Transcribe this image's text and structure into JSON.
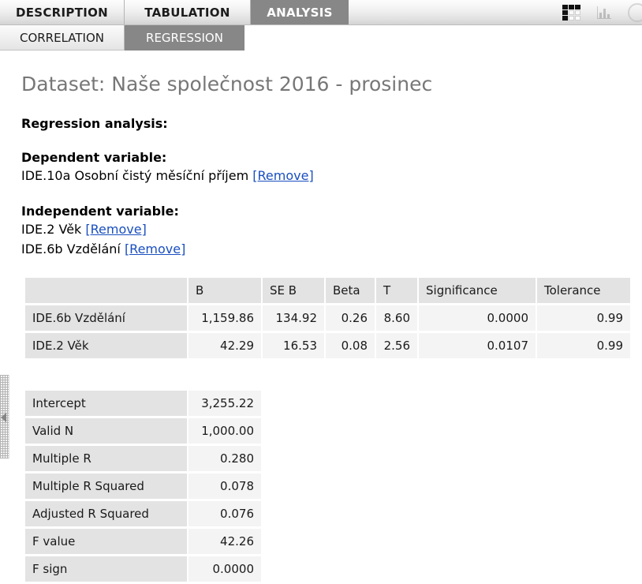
{
  "primary_tabs": [
    {
      "label": "DESCRIPTION",
      "active": false
    },
    {
      "label": "TABULATION",
      "active": false
    },
    {
      "label": "ANALYSIS",
      "active": true
    }
  ],
  "secondary_tabs": [
    {
      "label": "CORRELATION",
      "active": false
    },
    {
      "label": "REGRESSION",
      "active": true
    }
  ],
  "toolbar": {
    "grid_icon_name": "table-view-icon",
    "chart_icon_name": "chart-view-icon",
    "circle_icon_name": "pie-view-icon"
  },
  "content": {
    "dataset_title": "Dataset: Naše společnost 2016 - prosinec",
    "analysis_heading": "Regression analysis:",
    "dependent_heading": "Dependent variable:",
    "dependent_variable": "IDE.10a Osobní čistý měsíční příjem",
    "independent_heading": "Independent variable:",
    "independent_variables": [
      "IDE.2 Věk",
      "IDE.6b Vzdělání"
    ],
    "remove_label": "[Remove]"
  },
  "coefficients_table": {
    "headers": [
      "",
      "B",
      "SE B",
      "Beta",
      "T",
      "Significance",
      "Tolerance"
    ],
    "rows": [
      {
        "name": "IDE.6b Vzdělání",
        "B": "1,159.86",
        "SE_B": "134.92",
        "Beta": "0.26",
        "T": "8.60",
        "Significance": "0.0000",
        "Tolerance": "0.99"
      },
      {
        "name": "IDE.2 Věk",
        "B": "42.29",
        "SE_B": "16.53",
        "Beta": "0.08",
        "T": "2.56",
        "Significance": "0.0107",
        "Tolerance": "0.99"
      }
    ]
  },
  "summary_table": {
    "rows": [
      {
        "label": "Intercept",
        "value": "3,255.22"
      },
      {
        "label": "Valid N",
        "value": "1,000.00"
      },
      {
        "label": "Multiple R",
        "value": "0.280"
      },
      {
        "label": "Multiple R Squared",
        "value": "0.078"
      },
      {
        "label": "Adjusted R Squared",
        "value": "0.076"
      },
      {
        "label": "F value",
        "value": "42.26"
      },
      {
        "label": "F sign",
        "value": "0.0000"
      }
    ]
  },
  "colors": {
    "active_tab_bg": "#878787",
    "link": "#1a4fbf",
    "title_text": "#777777",
    "row_label_bg": "#e3e3e3",
    "row_value_bg": "#f4f4f4"
  }
}
